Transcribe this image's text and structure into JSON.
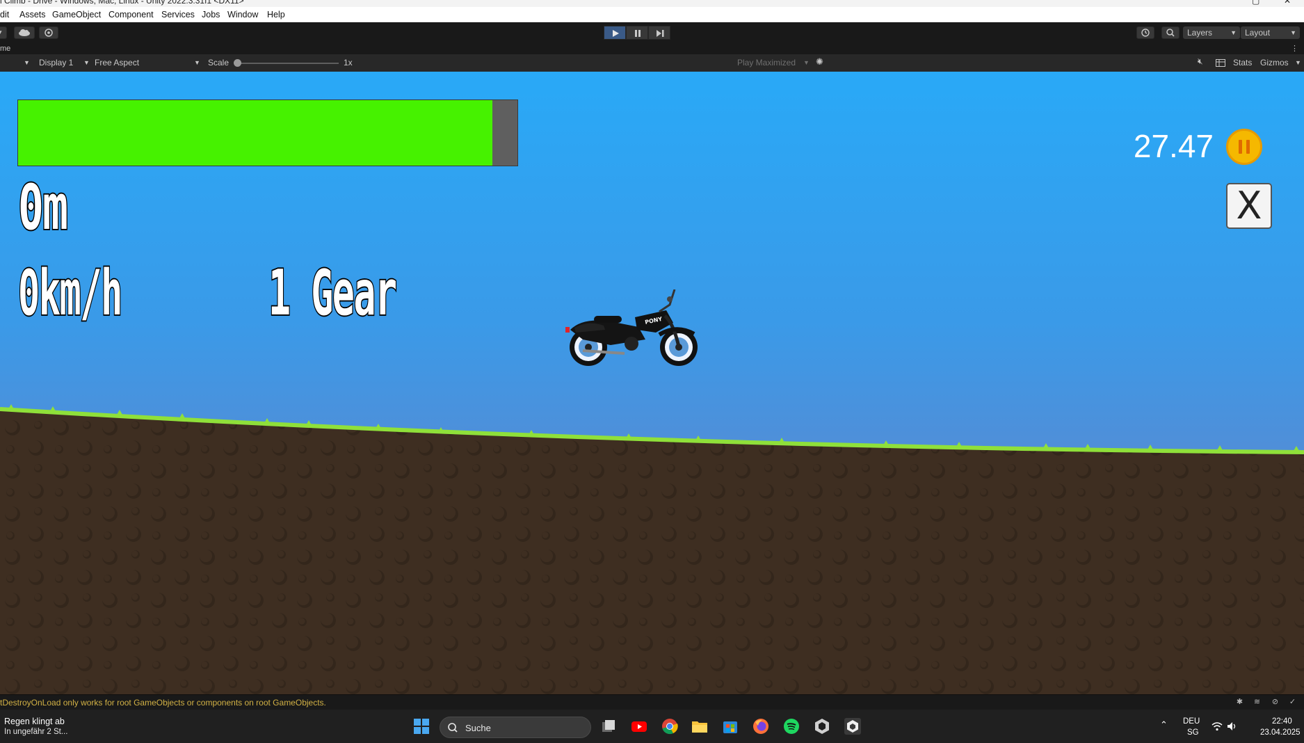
{
  "window": {
    "title": "l Climb - Drive - Windows, Mac, Linux - Unity 2022.3.31f1 <DX11>"
  },
  "menu": {
    "items": [
      "dit",
      "Assets",
      "GameObject",
      "Component",
      "Services",
      "Jobs",
      "Window",
      "Help"
    ]
  },
  "toolbar": {
    "layers_label": "Layers",
    "layout_label": "Layout"
  },
  "tab": {
    "label": "me"
  },
  "game_toolbar": {
    "display": "Display 1",
    "aspect": "Free Aspect",
    "scale_label": "Scale",
    "scale_value": "1x",
    "play_mode": "Play Maximized",
    "stats": "Stats",
    "gizmos": "Gizmos"
  },
  "hud": {
    "fuel_level": 0.95,
    "distance": "0m",
    "speed": "0km/h",
    "gear": "1 Gear",
    "coins": "27.47",
    "close_symbol": "X",
    "colors": {
      "fuel": "#46f200",
      "fuel_empty": "#5f5f5f",
      "grass": "#8fe03a",
      "dirt": "#3e2e21",
      "sky_top": "#29a9f7"
    }
  },
  "console": {
    "message": "tDestroyOnLoad only works for root GameObjects or components on root GameObjects."
  },
  "taskbar": {
    "weather_line1": "Regen klingt ab",
    "weather_line2": "In ungefähr 2 St...",
    "search_label": "Suche",
    "lang_line1": "DEU",
    "lang_line2": "SG",
    "time": "22:40",
    "date": "23.04.2025",
    "apps": [
      "start-icon",
      "task-view-icon",
      "youtube-icon",
      "chrome-icon",
      "file-explorer-icon",
      "store-icon",
      "firefox-icon",
      "spotify-icon",
      "unity-hub-icon",
      "unity-editor-icon"
    ]
  }
}
